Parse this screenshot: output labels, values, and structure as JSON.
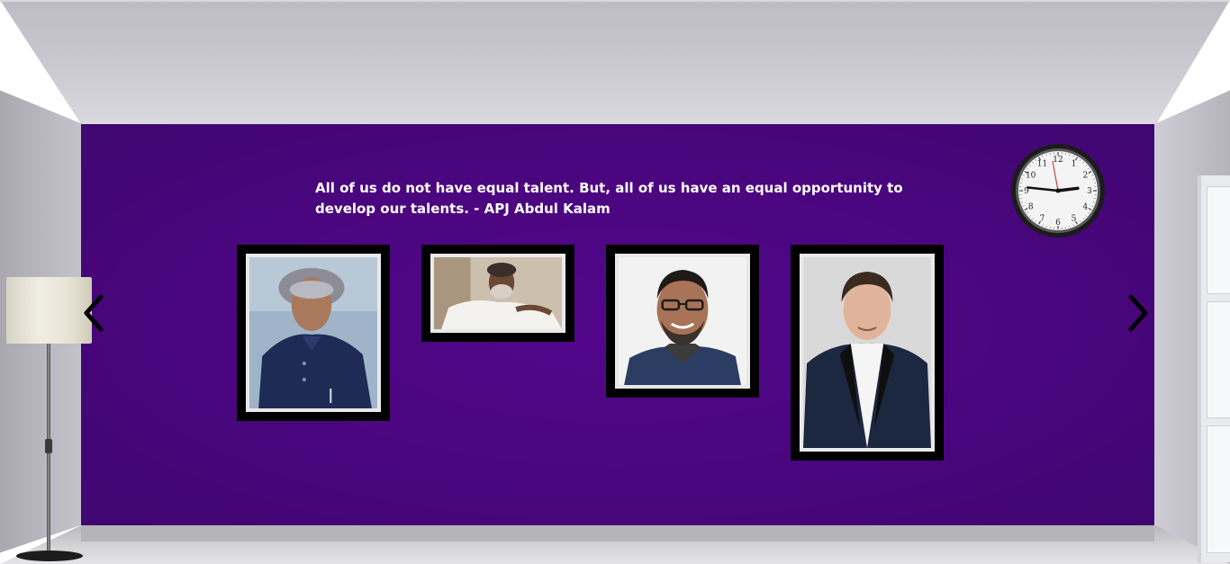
{
  "quote": {
    "text": "All of us do not have equal talent. But, all of us have an equal opportunity to develop our talents. - APJ Abdul Kalam"
  },
  "gallery": {
    "frames": [
      {
        "subject": "portrait-man-suit-white-hair"
      },
      {
        "subject": "portrait-man-white-shirt-smiling"
      },
      {
        "subject": "portrait-man-glasses-beard"
      },
      {
        "subject": "portrait-man-black-suit"
      }
    ]
  },
  "navigation": {
    "prev_icon": "chevron-left-icon",
    "next_icon": "chevron-right-icon"
  },
  "clock": {
    "numerals": [
      "12",
      "1",
      "2",
      "3",
      "4",
      "5",
      "6",
      "7",
      "8",
      "9",
      "10",
      "11"
    ],
    "time": "2:46"
  },
  "colors": {
    "wall": "#4a067e",
    "frame": "#000000",
    "quote_text": "#ffffff"
  }
}
